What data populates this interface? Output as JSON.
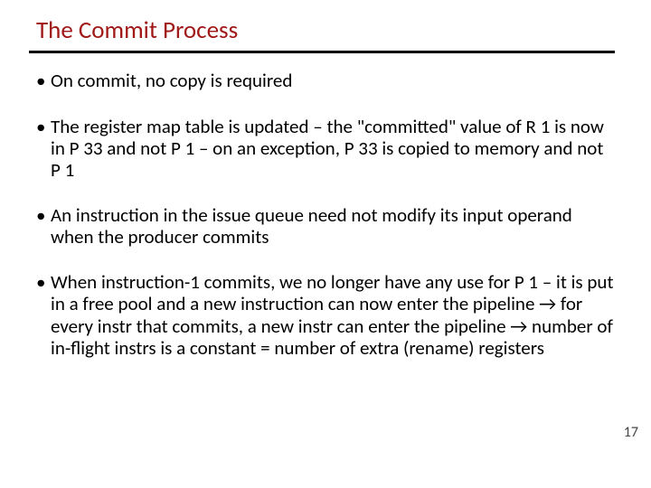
{
  "title": "The Commit Process",
  "bullets": [
    "On commit, no copy is required",
    "The register map table is updated – the \"committed\" value of R 1 is now in P 33 and not P 1 – on an exception, P 33 is copied to memory and not P 1",
    "An instruction in the issue queue need not modify its input operand when the producer commits",
    "When instruction-1 commits, we no longer have any use for P 1 – it is put in a free pool and a new instruction can now enter the pipeline → for every instr that commits, a new instr can enter the pipeline → number of in-flight instrs is a constant = number of extra (rename) registers"
  ],
  "page_number": "17"
}
